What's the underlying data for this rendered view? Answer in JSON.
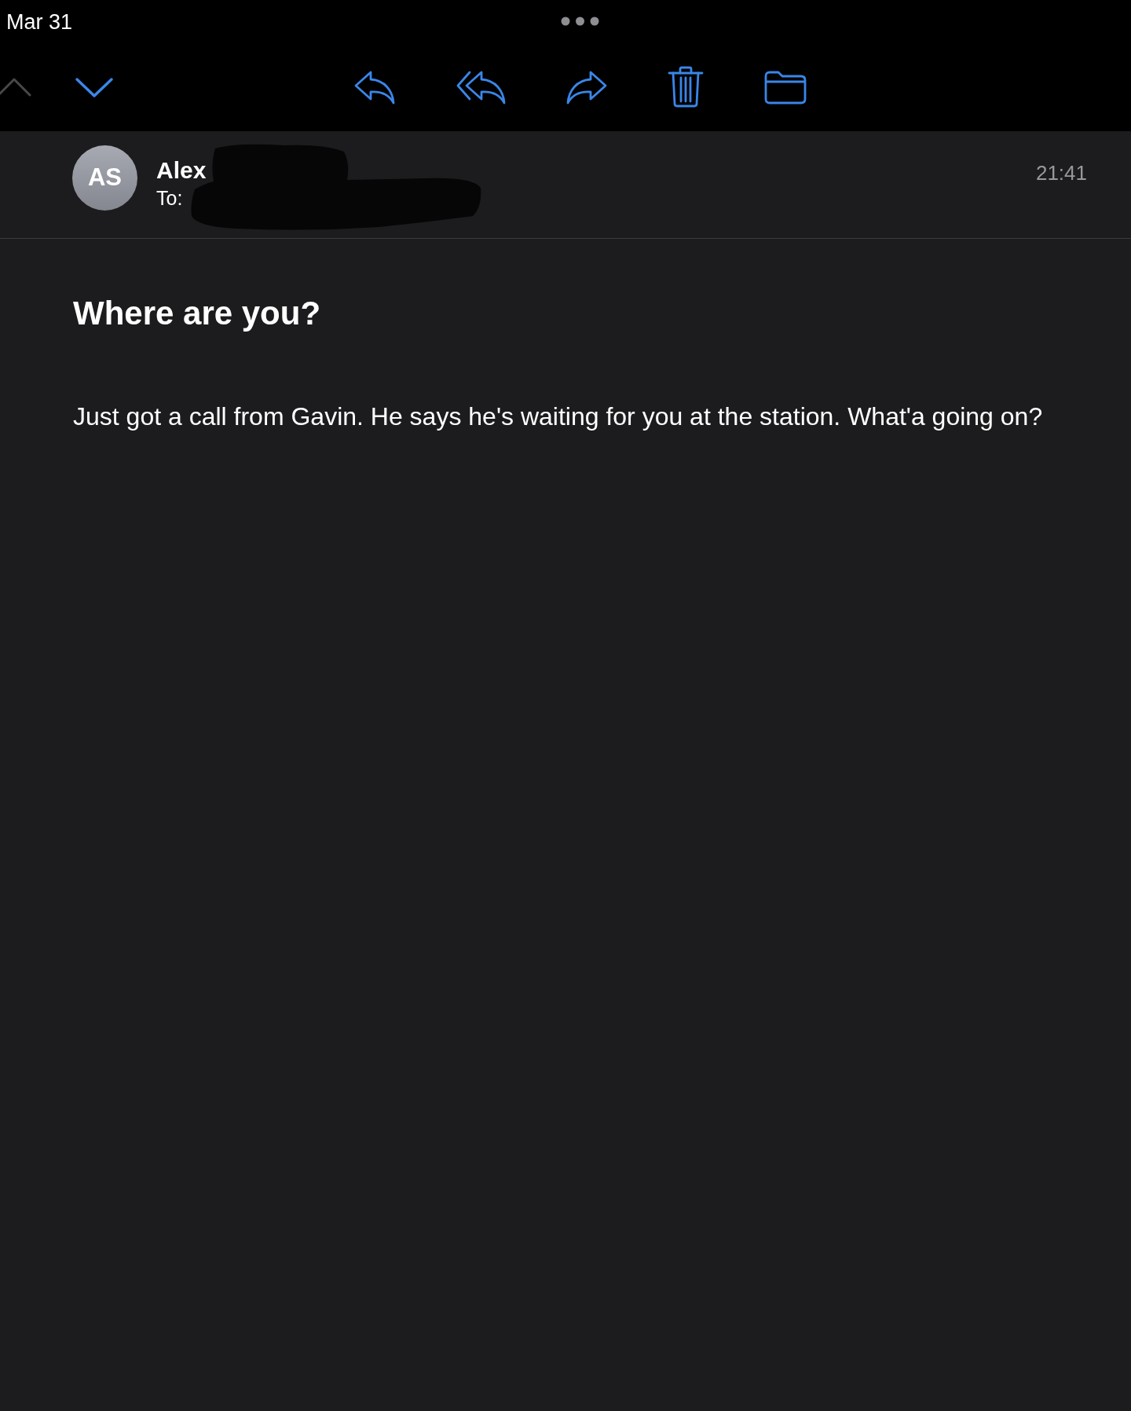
{
  "status_bar": {
    "date": "Mar 31"
  },
  "toolbar": {
    "buttons": [
      {
        "kind": "previous",
        "disabled": true
      },
      {
        "kind": "next",
        "disabled": false
      },
      {
        "kind": "reply",
        "disabled": false
      },
      {
        "kind": "reply_all",
        "disabled": false
      },
      {
        "kind": "forward",
        "disabled": false
      },
      {
        "kind": "trash",
        "disabled": false
      },
      {
        "kind": "folder",
        "disabled": false
      }
    ]
  },
  "message": {
    "sender": {
      "initials": "AS",
      "name": "Alex"
    },
    "recipient_label": "To:",
    "redacted": true,
    "time": "21:41",
    "subject": "Where are you?",
    "body": "Just got a call from Gavin. He says he's waiting for you at the station. What'a going on?"
  }
}
